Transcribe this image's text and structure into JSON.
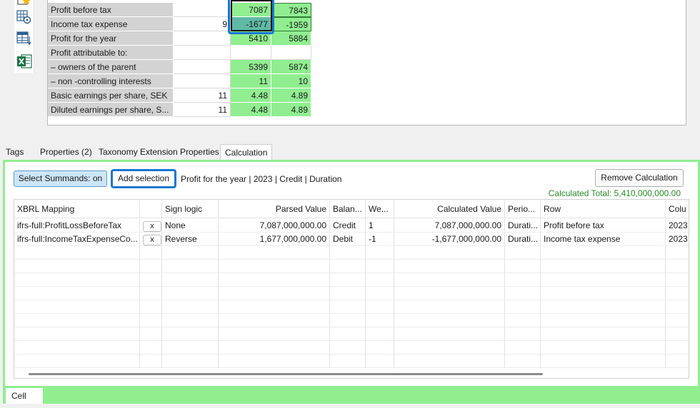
{
  "sheet": {
    "rows": [
      {
        "label": "Profit before tax",
        "note": "",
        "v1": "7087",
        "v2": "7843"
      },
      {
        "label": "Income tax expense",
        "note": "9",
        "v1": "-1677",
        "v2": "-1959"
      },
      {
        "label": "Profit for the year",
        "note": "",
        "v1": "5410",
        "v2": "5884"
      },
      {
        "label": "Profit attributable to:",
        "note": "",
        "v1": "",
        "v2": ""
      },
      {
        "label": "– owners of the parent",
        "note": "",
        "v1": "5399",
        "v2": "5874"
      },
      {
        "label": "– non -controlling interests",
        "note": "",
        "v1": "11",
        "v2": "10"
      },
      {
        "label": "Basic earnings per share, SEK",
        "note": "11",
        "v1": "4.48",
        "v2": "4.89"
      },
      {
        "label": "Diluted earnings per share, S...",
        "note": "11",
        "v1": "4.48",
        "v2": "4.89"
      }
    ]
  },
  "toolbar": {
    "icons": [
      "star-icon",
      "table-settings-icon",
      "table-sort-icon",
      "excel-icon"
    ]
  },
  "tabs": [
    {
      "label": "Tags"
    },
    {
      "label": "Properties (2)"
    },
    {
      "label": "Taxonomy Extension Properties"
    },
    {
      "label": "Calculation"
    }
  ],
  "calc": {
    "summands_label": "Select Summands: on",
    "add_selection_label": "Add selection",
    "description": "Profit for the year | 2023 | Credit | Duration",
    "remove_label": "Remove Calculation",
    "total": "Calculated Total: 5,410,000,000.00",
    "columns": [
      "XBRL Mapping",
      "",
      "Sign logic",
      "Parsed Value",
      "Balan...",
      "We...",
      "Calculated Value",
      "Perio...",
      "Row",
      "Colu"
    ],
    "rows": [
      {
        "mapping": "ifrs-full:ProfitLossBeforeTax",
        "remove": "x",
        "sign": "None",
        "parsed": "7,087,000,000.00",
        "balance": "Credit",
        "weight": "1",
        "calculated": "7,087,000,000.00",
        "period": "Durati...",
        "row": "Profit before tax",
        "col": "2023"
      },
      {
        "mapping": "ifrs-full:IncomeTaxExpenseCo...",
        "remove": "x",
        "sign": "Reverse",
        "parsed": "1,677,000,000.00",
        "balance": "Debit",
        "weight": "-1",
        "calculated": "-1,677,000,000.00",
        "period": "Durati...",
        "row": "Income tax expense",
        "col": "2023"
      }
    ]
  },
  "bottom": {
    "cell_tab": "Cell"
  },
  "colors": {
    "accent_green": "#90ee90",
    "selection_blue": "#1976d2",
    "total_green": "#2a8a2a"
  }
}
